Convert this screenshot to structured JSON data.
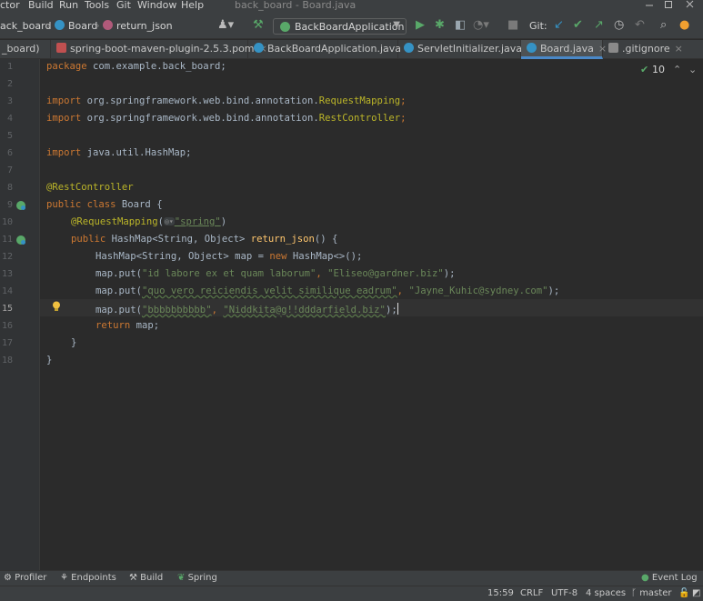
{
  "menu": {
    "items": [
      "ctor",
      "Build",
      "Run",
      "Tools",
      "Git",
      "Window",
      "Help"
    ],
    "title": "back_board - Board.java"
  },
  "breadcrumb": {
    "project": "ack_board",
    "class": "Board",
    "method": "return_json"
  },
  "run_config": {
    "label": "BackBoardApplication"
  },
  "git_label": "Git:",
  "tabs": [
    {
      "label": "_board)",
      "icon": "module-icon",
      "active": false
    },
    {
      "label": "spring-boot-maven-plugin-2.5.3.pom",
      "icon": "maven-icon",
      "active": false
    },
    {
      "label": "BackBoardApplication.java",
      "icon": "class-icon",
      "active": false
    },
    {
      "label": "ServletInitializer.java",
      "icon": "class-icon",
      "active": false
    },
    {
      "label": "Board.java",
      "icon": "class-icon",
      "active": true
    },
    {
      "label": ".gitignore",
      "icon": "ignore-file-icon",
      "active": false
    }
  ],
  "inspection": {
    "count": "10"
  },
  "editor": {
    "line_numbers": [
      "1",
      "2",
      "3",
      "4",
      "5",
      "6",
      "7",
      "8",
      "9",
      "10",
      "11",
      "12",
      "13",
      "14",
      "15",
      "16",
      "17",
      "18"
    ],
    "current_line": "15",
    "code": {
      "l1_kw": "package",
      "l1_rest": " com.example.back_board;",
      "l3_kw": "import",
      "l3_rest": " org.springframework.web.bind.annotation.",
      "l3_cls": "RequestMapping",
      "l3_end": ";",
      "l4_kw": "import",
      "l4_rest": " org.springframework.web.bind.annotation.",
      "l4_cls": "RestController",
      "l4_end": ";",
      "l6_kw": "import",
      "l6_rest": " java.util.HashMap;",
      "l8_ann": "@RestController",
      "l9_kw": "public class",
      "l9_rest": " Board {",
      "l10_ann": "@RequestMapping",
      "l10_open": "(",
      "l10_str": "\"spring\"",
      "l10_close": ")",
      "l11_kw": "public",
      "l11_type": " HashMap<String, Object> ",
      "l11_fn": "return_json",
      "l11_rest": "() {",
      "l12_a": "HashMap<String, Object> map = ",
      "l12_kw": "new",
      "l12_b": " HashMap<>();",
      "l13_a": "map.put(",
      "l13_s1": "\"id labore ex et quam laborum\"",
      "l13_c": ", ",
      "l13_s2": "\"Eliseo@gardner.biz\"",
      "l13_end": ");",
      "l14_a": "map.put(",
      "l14_s1": "\"quo vero reiciendis velit similique eadrum\"",
      "l14_c": ", ",
      "l14_s2": "\"Jayne_Kuhic@sydney.com\"",
      "l14_end": ");",
      "l15_a": "map.put(",
      "l15_s1": "\"bbbbbbbbbb\"",
      "l15_c": ", ",
      "l15_s2": "\"Niddkita@g!!dddarfield.biz\"",
      "l15_end": ");",
      "l16_kw": "return",
      "l16_rest": " map;",
      "l17": "}",
      "l18": "}"
    }
  },
  "tool_windows": [
    {
      "label": "Profiler",
      "icon": "profiler-icon"
    },
    {
      "label": "Endpoints",
      "icon": "endpoints-icon"
    },
    {
      "label": "Build",
      "icon": "hammer-icon"
    },
    {
      "label": "Spring",
      "icon": "spring-icon"
    }
  ],
  "event_log": "Event Log",
  "status": {
    "position": "15:59",
    "line_sep": "CRLF",
    "encoding": "UTF-8",
    "indent": "4 spaces",
    "branch": "master"
  },
  "colors": {
    "accent": "#4a88c7",
    "keyword": "#cc7832",
    "string": "#6a8759",
    "annotation": "#bbb529",
    "run_green": "#59a869"
  }
}
